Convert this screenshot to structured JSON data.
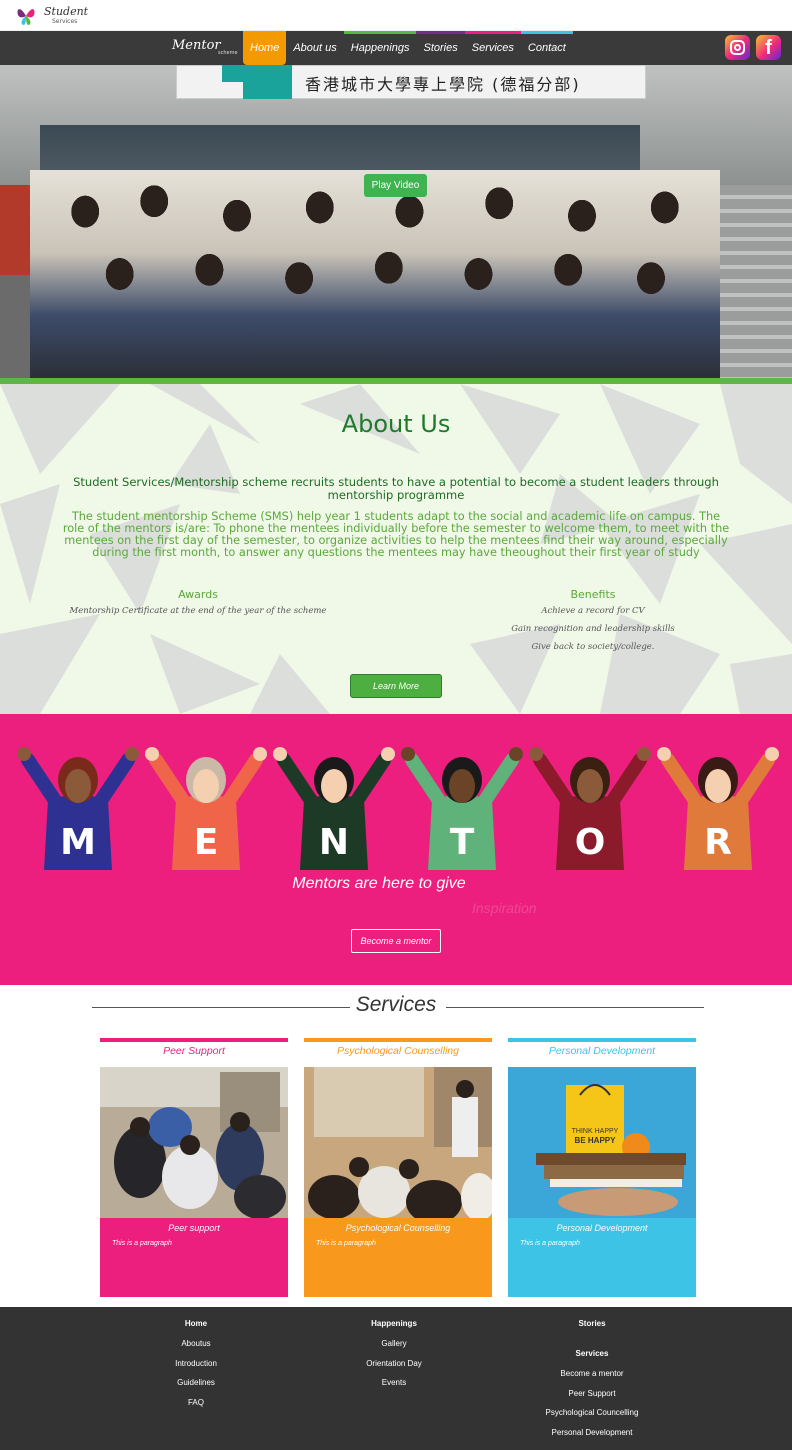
{
  "brand": {
    "logo_text": "Student",
    "logo_sub": "Services",
    "nav_logo": "Mentor",
    "nav_logo_sub": "scheme"
  },
  "nav": {
    "items": [
      {
        "label": "Home",
        "active": true,
        "bar_color": "#f39a00"
      },
      {
        "label": "About us",
        "bar_color": "#3a3a3a"
      },
      {
        "label": "Happenings",
        "bar_color": "#59b943"
      },
      {
        "label": "Stories",
        "bar_color": "#7a2c7e"
      },
      {
        "label": "Services",
        "bar_color": "#ec1f7e"
      },
      {
        "label": "Contact",
        "bar_color": "#3cc3e6"
      }
    ],
    "social": [
      "instagram-icon",
      "facebook-icon"
    ],
    "facebook_glyph": "f"
  },
  "hero": {
    "sign_text": "香港城市大學專上學院 (德福分部)",
    "play_label": "Play Video"
  },
  "about": {
    "title": "About Us",
    "subtitle": "Student Services/Mentorship scheme recruits students to have a potential to become a student leaders through mentorship programme",
    "description": "The student mentorship Scheme (SMS) help year 1 students adapt to the social and academic life on campus. The role of the mentors is/are: To phone the mentees individually before the semester to welcome them, to meet with the mentees on the first day of the semester, to organize activities to help the mentees find their way around, especially during the first month, to answer any questions the mentees may have theoughout their first year of study",
    "awards": {
      "title": "Awards",
      "items": [
        "Mentorship Certificate at the end of the year of the scheme"
      ]
    },
    "benefits": {
      "title": "Benefits",
      "items": [
        "Achieve a record for CV",
        "Gain recognition and leadership skills",
        "Give back to society/college."
      ]
    },
    "button": "Learn More"
  },
  "mentor": {
    "letters": [
      "M",
      "E",
      "N",
      "T",
      "O",
      "R"
    ],
    "shirt_colors": [
      "#2e3192",
      "#f0644a",
      "#1c3a26",
      "#5fb27a",
      "#8b1a2b",
      "#e07a3a"
    ],
    "tagline": "Mentors are here to give",
    "fade_word": "Inspiration",
    "button": "Become a mentor"
  },
  "services": {
    "title": "Services",
    "cards": [
      {
        "title": "Peer Support",
        "color": "#ec1f7e",
        "body_title": "Peer support",
        "para": "This is a paragraph"
      },
      {
        "title": "Psychological Counselling",
        "color": "#f8991d",
        "body_title": "Psychological Counselling",
        "para": "This is a paragraph"
      },
      {
        "title": "Personal Development",
        "color": "#3cc3e6",
        "body_title": "Personal Development",
        "para": "This is a paragraph"
      }
    ],
    "box_text_1": "THINK HAPPY",
    "box_text_2": "BE HAPPY"
  },
  "footer": {
    "col1": {
      "head": "Home",
      "links": [
        "Aboutus",
        "Introduction",
        "Guidelines",
        "FAQ"
      ]
    },
    "col2": {
      "head": "Happenings",
      "links": [
        "Gallery",
        "Orientation Day",
        "Events"
      ]
    },
    "col3": {
      "head": "Stories",
      "head2": "Services",
      "links": [
        "Become a mentor",
        "Peer Support",
        "Psychological Councelling",
        "Personal Development"
      ]
    }
  }
}
